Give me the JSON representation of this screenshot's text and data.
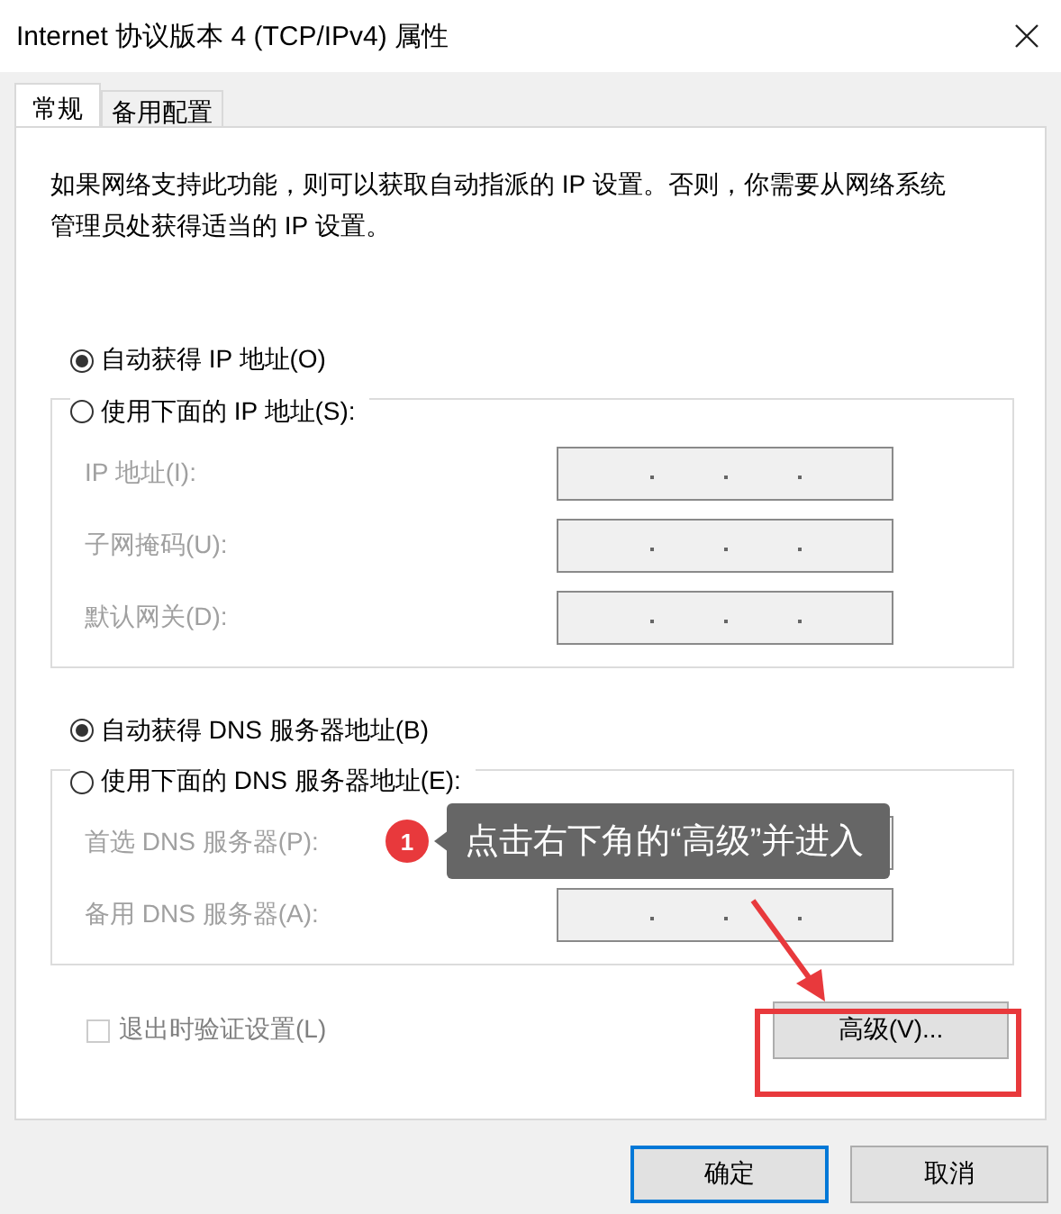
{
  "window": {
    "title": "Internet 协议版本 4 (TCP/IPv4) 属性"
  },
  "tabs": [
    {
      "label": "常规",
      "selected": true
    },
    {
      "label": "备用配置",
      "selected": false
    }
  ],
  "description": "如果网络支持此功能，则可以获取自动指派的 IP 设置。否则，你需要从网络系统管理员处获得适当的 IP 设置。",
  "ip_options": [
    {
      "label": "自动获得 IP 地址(O)",
      "selected": true
    },
    {
      "label": "使用下面的 IP 地址(S):",
      "selected": false
    }
  ],
  "ip_fields": [
    {
      "label": "IP 地址(I):",
      "disabled": true
    },
    {
      "label": "子网掩码(U):",
      "disabled": true
    },
    {
      "label": "默认网关(D):",
      "disabled": true
    }
  ],
  "dns_options": [
    {
      "label": "自动获得 DNS 服务器地址(B)",
      "selected": true
    },
    {
      "label": "使用下面的 DNS 服务器地址(E):",
      "selected": false
    }
  ],
  "dns_fields": [
    {
      "label": "首选 DNS 服务器(P):",
      "disabled": true
    },
    {
      "label": "备用 DNS 服务器(A):",
      "disabled": true
    }
  ],
  "validate_checkbox": {
    "label": "退出时验证设置(L)",
    "checked": false,
    "disabled": true
  },
  "advanced_button": {
    "label": "高级(V)...",
    "highlighted": true
  },
  "annotation": {
    "number": "1",
    "text": "点击右下角的“高级”并进入"
  },
  "buttons": [
    {
      "label": "确定",
      "default": true
    },
    {
      "label": "取消",
      "default": false
    }
  ]
}
